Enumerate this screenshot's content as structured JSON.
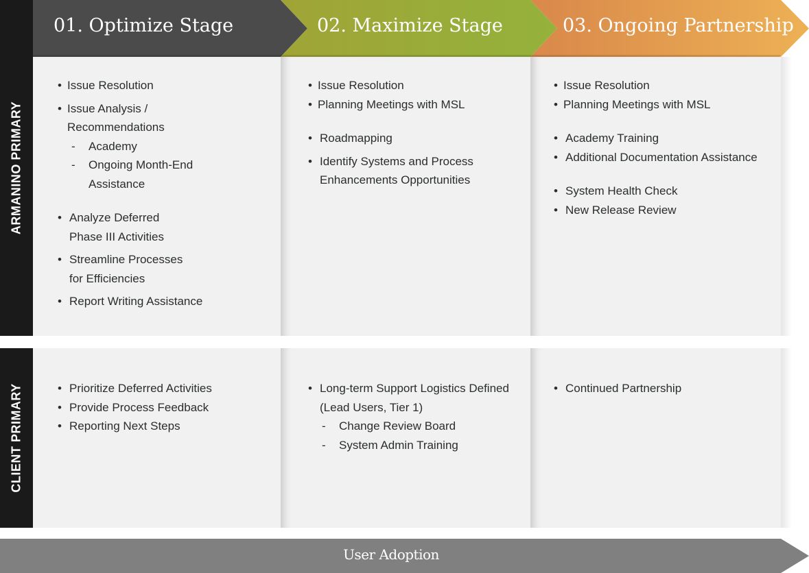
{
  "stages": [
    {
      "label": "01. Optimize Stage",
      "color": "#4b4b4b"
    },
    {
      "label": "02. Maximize Stage",
      "color_start": "#a0a436",
      "color_end": "#94b23c"
    },
    {
      "label": "03. Ongoing Partnership",
      "color_start": "#d9884a",
      "color_end": "#edb155"
    }
  ],
  "rows": [
    {
      "label": "ARMANINO PRIMARY"
    },
    {
      "label": "CLIENT PRIMARY"
    }
  ],
  "cells": {
    "armanino": [
      {
        "items": [
          {
            "type": "bullet",
            "text": "Issue Resolution"
          },
          {
            "type": "bullet",
            "text": "Issue Analysis /"
          },
          {
            "type": "cont",
            "text": "Recommendations"
          },
          {
            "type": "sub",
            "text": "Academy"
          },
          {
            "type": "sub",
            "text": "Ongoing Month-End"
          },
          {
            "type": "subcont",
            "text": "Assistance"
          },
          {
            "type": "bullet",
            "text": "Analyze Deferred"
          },
          {
            "type": "cont",
            "text": "Phase III Activities"
          },
          {
            "type": "bullet",
            "text": "Streamline Processes"
          },
          {
            "type": "cont",
            "text": "for Efficiencies"
          },
          {
            "type": "bullet",
            "text": "Report Writing Assistance"
          }
        ]
      },
      {
        "items": [
          {
            "type": "bullet",
            "text": "Issue Resolution"
          },
          {
            "type": "bullet",
            "text": "Planning Meetings with MSL"
          },
          {
            "type": "bullet",
            "text": "Roadmapping"
          },
          {
            "type": "bullet",
            "text": "Identify Systems and Process"
          },
          {
            "type": "cont",
            "text": "Enhancements Opportunities"
          }
        ]
      },
      {
        "items": [
          {
            "type": "bullet",
            "text": "Issue Resolution"
          },
          {
            "type": "bullet",
            "text": "Planning Meetings with MSL"
          },
          {
            "type": "bullet",
            "text": "Academy Training"
          },
          {
            "type": "bullet",
            "text": "Additional Documentation Assistance"
          },
          {
            "type": "bullet",
            "text": "System Health Check"
          },
          {
            "type": "bullet",
            "text": "New Release Review"
          }
        ]
      }
    ],
    "client": [
      {
        "items": [
          {
            "type": "bullet",
            "text": "Prioritize Deferred Activities"
          },
          {
            "type": "bullet",
            "text": "Provide Process Feedback"
          },
          {
            "type": "bullet",
            "text": "Reporting Next Steps"
          }
        ]
      },
      {
        "items": [
          {
            "type": "bullet",
            "text": "Long-term Support Logistics Defined"
          },
          {
            "type": "cont",
            "text": "(Lead Users, Tier 1)"
          },
          {
            "type": "sub",
            "text": "Change Review Board"
          },
          {
            "type": "sub",
            "text": "System Admin Training"
          }
        ]
      },
      {
        "items": [
          {
            "type": "bullet",
            "text": "Continued Partnership"
          }
        ]
      }
    ]
  },
  "bullet_glyph": "•",
  "dash_glyph": "-",
  "footer": {
    "label": "User Adoption",
    "color": "#808080"
  }
}
